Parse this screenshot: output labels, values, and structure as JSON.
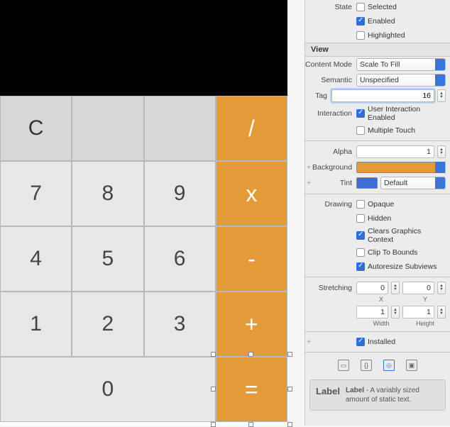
{
  "calculator": {
    "rows": [
      [
        "C",
        "",
        "",
        "/"
      ],
      [
        "7",
        "8",
        "9",
        "x"
      ],
      [
        "4",
        "5",
        "6",
        "-"
      ],
      [
        "1",
        "2",
        "3",
        "+"
      ]
    ],
    "zero": "0",
    "equals": "="
  },
  "inspector": {
    "state": {
      "label": "State",
      "selected": {
        "label": "Selected",
        "checked": false
      },
      "enabled": {
        "label": "Enabled",
        "checked": true
      },
      "highlighted": {
        "label": "Highlighted",
        "checked": false
      }
    },
    "view_header": "View",
    "content_mode": {
      "label": "Content Mode",
      "value": "Scale To Fill"
    },
    "semantic": {
      "label": "Semantic",
      "value": "Unspecified"
    },
    "tag": {
      "label": "Tag",
      "value": "16"
    },
    "interaction": {
      "label": "Interaction",
      "user_interaction": {
        "label": "User Interaction Enabled",
        "checked": true
      },
      "multiple_touch": {
        "label": "Multiple Touch",
        "checked": false
      }
    },
    "alpha": {
      "label": "Alpha",
      "value": "1"
    },
    "background": {
      "label": "Background"
    },
    "tint": {
      "label": "Tint",
      "value": "Default"
    },
    "drawing": {
      "label": "Drawing",
      "opaque": {
        "label": "Opaque",
        "checked": false
      },
      "hidden": {
        "label": "Hidden",
        "checked": false
      },
      "clears": {
        "label": "Clears Graphics Context",
        "checked": true
      },
      "clip": {
        "label": "Clip To Bounds",
        "checked": false
      },
      "autoresize": {
        "label": "Autoresize Subviews",
        "checked": true
      }
    },
    "stretching": {
      "label": "Stretching",
      "x": {
        "label": "X",
        "value": "0"
      },
      "y": {
        "label": "Y",
        "value": "0"
      },
      "width": {
        "label": "Width",
        "value": "1"
      },
      "height": {
        "label": "Height",
        "value": "1"
      }
    },
    "installed": {
      "label": "Installed",
      "checked": true
    },
    "library": {
      "title": "Label",
      "name": "Label",
      "desc": " - A variably sized amount of static text."
    }
  }
}
